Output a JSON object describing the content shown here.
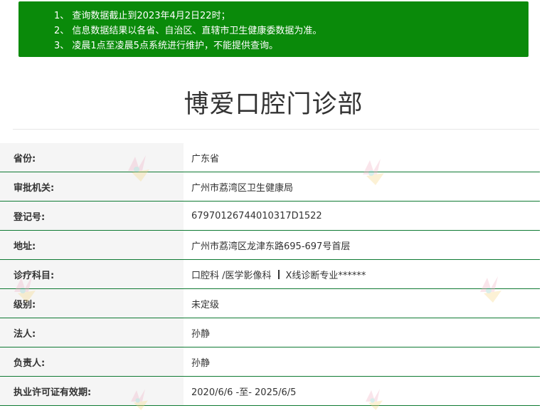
{
  "notice": {
    "lines": [
      "1、 查询数据截止到2023年4月2日22时；",
      "2、 信息数据结果以各省、自治区、直辖市卫生健康委数据为准。",
      "3、 凌晨1点至凌晨5点系统进行维护，不能提供查询。"
    ]
  },
  "title": "博爱口腔门诊部",
  "rows": [
    {
      "label": "省份:",
      "value": "广东省"
    },
    {
      "label": "审批机关:",
      "value": "广州市荔湾区卫生健康局"
    },
    {
      "label": "登记号:",
      "value": "67970126744010317D1522"
    },
    {
      "label": "地址:",
      "value": "广州市荔湾区龙津东路695-697号首层"
    },
    {
      "label": "诊疗科目:",
      "value_part1": "口腔科 /医学影像科",
      "value_part2": "X线诊断专业******"
    },
    {
      "label": "级别:",
      "value": "未定级"
    },
    {
      "label": "法人:",
      "value": "孙静"
    },
    {
      "label": "负责人:",
      "value": "孙静"
    },
    {
      "label": "执业许可证有效期:",
      "value": "2020/6/6 -至- 2025/6/5"
    }
  ]
}
